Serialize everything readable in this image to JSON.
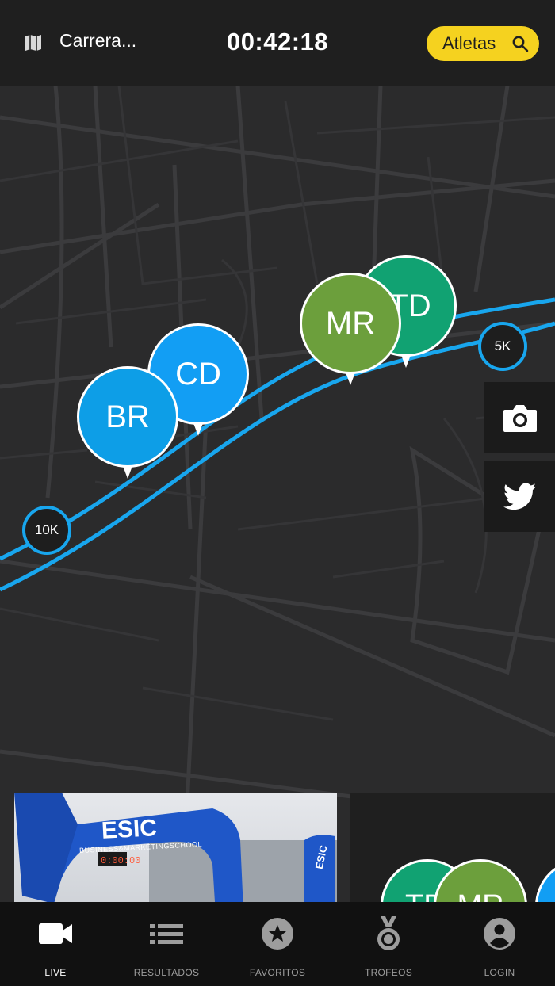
{
  "header": {
    "map_icon": "map-icon",
    "race_name": "Carrera...",
    "timer": "00:42:18",
    "athletes_button": "Atletas",
    "athletes_icon": "search-icon",
    "accent": "#f5d21f"
  },
  "map": {
    "route_color": "#18a6ee",
    "km_markers": [
      {
        "label": "5K"
      },
      {
        "label": "10K"
      }
    ],
    "runners": [
      {
        "initials": "TD",
        "color": "#11a272"
      },
      {
        "initials": "MR",
        "color": "#6c9f3c"
      },
      {
        "initials": "CD",
        "color": "#129ef4"
      },
      {
        "initials": "BR",
        "color": "#0d9ee7"
      }
    ],
    "side_buttons": [
      {
        "icon": "camera-icon"
      },
      {
        "icon": "twitter-icon"
      }
    ]
  },
  "cards": {
    "video": {
      "arch_brand": "ESIC",
      "arch_tagline": "BUSINESS&MARKETINGSCHOOL",
      "clock": "0:00:00",
      "flag_text": "ESIC"
    },
    "track": {
      "runners": [
        {
          "initials": "TD",
          "color": "#11a272"
        },
        {
          "initials": "MR",
          "color": "#6c9f3c"
        }
      ],
      "elevation_icon": "mountain-icon"
    }
  },
  "nav": [
    {
      "label": "LIVE",
      "icon": "video-camera-icon",
      "active": true
    },
    {
      "label": "RESULTADOS",
      "icon": "list-icon",
      "active": false
    },
    {
      "label": "FAVORITOS",
      "icon": "star-icon",
      "active": false
    },
    {
      "label": "TROFEOS",
      "icon": "medal-icon",
      "active": false
    },
    {
      "label": "LOGIN",
      "icon": "account-icon",
      "active": false
    }
  ]
}
